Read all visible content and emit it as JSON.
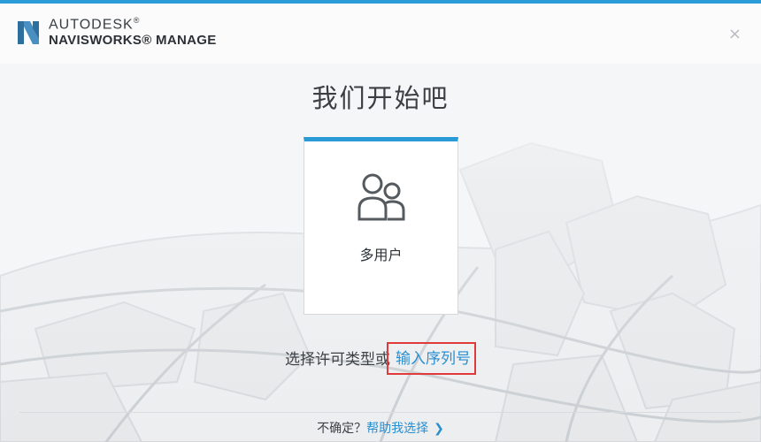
{
  "window": {
    "brand_line1": "AUTODESK",
    "brand_mark": "®",
    "brand_line2": "NAVISWORKS® MANAGE",
    "close_icon": "×"
  },
  "main": {
    "title": "我们开始吧",
    "license_card": {
      "icon": "multi-user-icon",
      "label": "多用户"
    },
    "prompt_text": "选择许可类型或",
    "serial_link": "输入序列号"
  },
  "footer": {
    "question": "不确定？",
    "help_link": "帮助我选择",
    "chevron": "❯"
  },
  "colors": {
    "accent": "#2a9bd7",
    "link": "#2a8fd0",
    "highlight_box": "#e03a3a"
  }
}
